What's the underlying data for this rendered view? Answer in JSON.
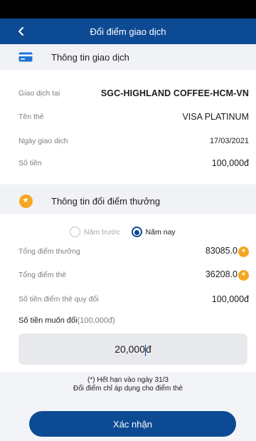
{
  "header": {
    "title": "Đổi điểm giao dịch"
  },
  "transaction": {
    "title": "Thông tin giao dịch",
    "rows": [
      {
        "label": "Giao dịch tại",
        "value": "SGC-HIGHLAND COFFEE-HCM-VN"
      },
      {
        "label": "Tên thẻ",
        "value": "VISA PLATINUM"
      },
      {
        "label": "Ngày giao dịch",
        "value": "17/03/2021"
      },
      {
        "label": "Số tiền",
        "value": "100,000đ"
      }
    ]
  },
  "reward": {
    "title": "Thông tin đổi điểm thưởng",
    "options": [
      {
        "label": "Năm trước",
        "selected": false
      },
      {
        "label": "Năm nay",
        "selected": true
      }
    ],
    "rows": [
      {
        "label": "Tổng điểm thưởng",
        "value": "83085.0"
      },
      {
        "label": "Tổng điểm thẻ",
        "value": "36208.0"
      },
      {
        "label": "Số tiền điểm thẻ quy đổi",
        "value": "100,000đ"
      }
    ],
    "amount_label": "Số tiền muốn đổi",
    "amount_hint": "(100,000đ)",
    "amount_value_a": "20,000",
    "amount_value_b": "đ"
  },
  "notes": {
    "line1": "(*) Hết hạn vào ngày 31/3",
    "line2": "Đổi điểm chỉ áp dụng cho điểm thẻ"
  },
  "confirm_label": "Xác nhận",
  "colors": {
    "primary": "#0d4a94",
    "accent": "#f6a623",
    "background": "#f3f4f7"
  }
}
